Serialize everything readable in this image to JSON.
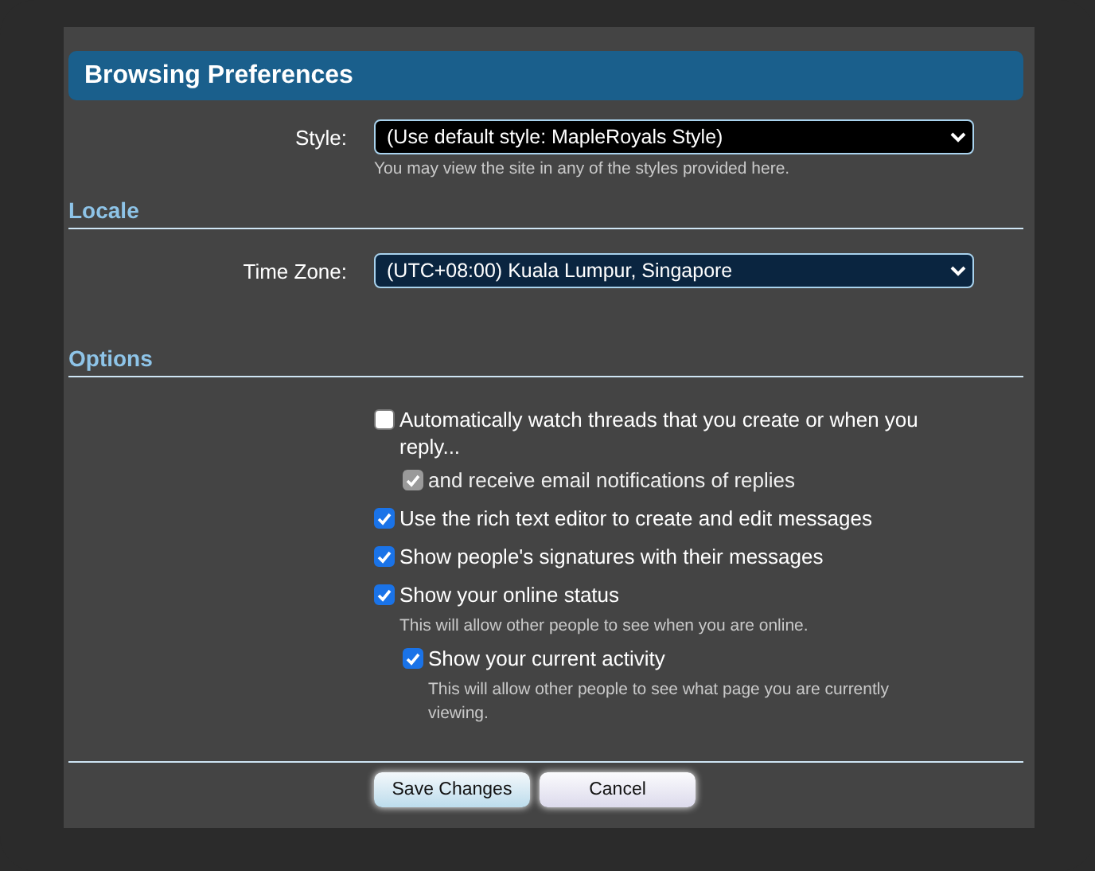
{
  "dialog": {
    "title": "Browsing Preferences",
    "style": {
      "label": "Style:",
      "value": "(Use default style: MapleRoyals Style)",
      "hint": "You may view the site in any of the styles provided here."
    },
    "locale": {
      "heading": "Locale",
      "time_zone": {
        "label": "Time Zone:",
        "value": "(UTC+08:00) Kuala Lumpur, Singapore"
      }
    },
    "options": {
      "heading": "Options",
      "items": [
        {
          "label": "Automatically watch threads that you create or when you reply...",
          "checked": false,
          "disabled": false,
          "children": [
            {
              "label": "and receive email notifications of replies",
              "checked": true,
              "disabled": true
            }
          ]
        },
        {
          "label": "Use the rich text editor to create and edit messages",
          "checked": true,
          "disabled": false
        },
        {
          "label": "Show people's signatures with their messages",
          "checked": true,
          "disabled": false
        },
        {
          "label": "Show your online status",
          "checked": true,
          "disabled": false,
          "hint": "This will allow other people to see when you are online.",
          "children": [
            {
              "label": "Show your current activity",
              "checked": true,
              "disabled": false,
              "hint": "This will allow other people to see what page you are currently viewing."
            }
          ]
        }
      ]
    },
    "buttons": [
      {
        "label": "Save Changes",
        "kind": "primary"
      },
      {
        "label": "Cancel",
        "kind": "secondary"
      }
    ]
  }
}
